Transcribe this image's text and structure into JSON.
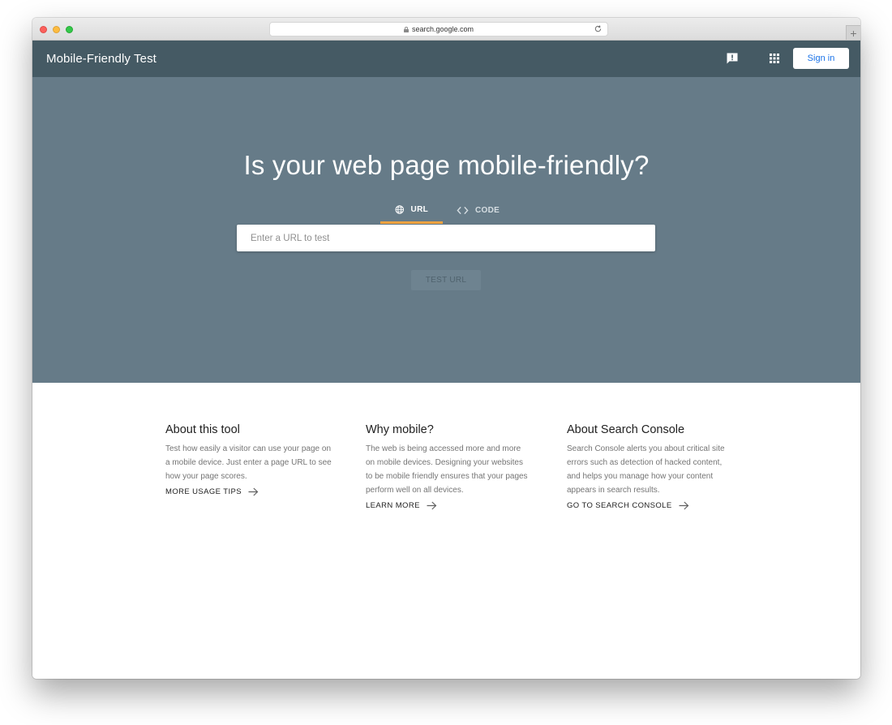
{
  "browser": {
    "url": "search.google.com",
    "new_tab_label": "+"
  },
  "header": {
    "title": "Mobile-Friendly Test",
    "feedback_icon": "feedback-icon",
    "apps_icon": "apps-grid-icon",
    "signin_label": "Sign in"
  },
  "hero": {
    "title": "Is your web page mobile-friendly?",
    "tabs": [
      {
        "label": "URL",
        "icon": "globe-icon",
        "active": true
      },
      {
        "label": "CODE",
        "icon": "code-icon",
        "active": false
      }
    ],
    "input_placeholder": "Enter a URL to test",
    "input_value": "",
    "test_button_label": "TEST URL"
  },
  "info": {
    "columns": [
      {
        "title": "About this tool",
        "text": "Test how easily a visitor can use your page on a mobile device. Just enter a page URL to see how your page scores.",
        "link": "MORE USAGE TIPS"
      },
      {
        "title": "Why mobile?",
        "text": "The web is being accessed more and more on mobile devices. Designing your websites to be mobile friendly ensures that your pages perform well on all devices.",
        "link": "LEARN MORE"
      },
      {
        "title": "About Search Console",
        "text": "Search Console alerts you about critical site errors such as detection of hacked content, and helps you manage how your content appears in search results.",
        "link": "GO TO SEARCH CONSOLE"
      }
    ]
  },
  "colors": {
    "header_bg": "#455a64",
    "hero_bg": "#667b88",
    "tab_underline": "#f4a340",
    "signin_text": "#1a73e8"
  }
}
